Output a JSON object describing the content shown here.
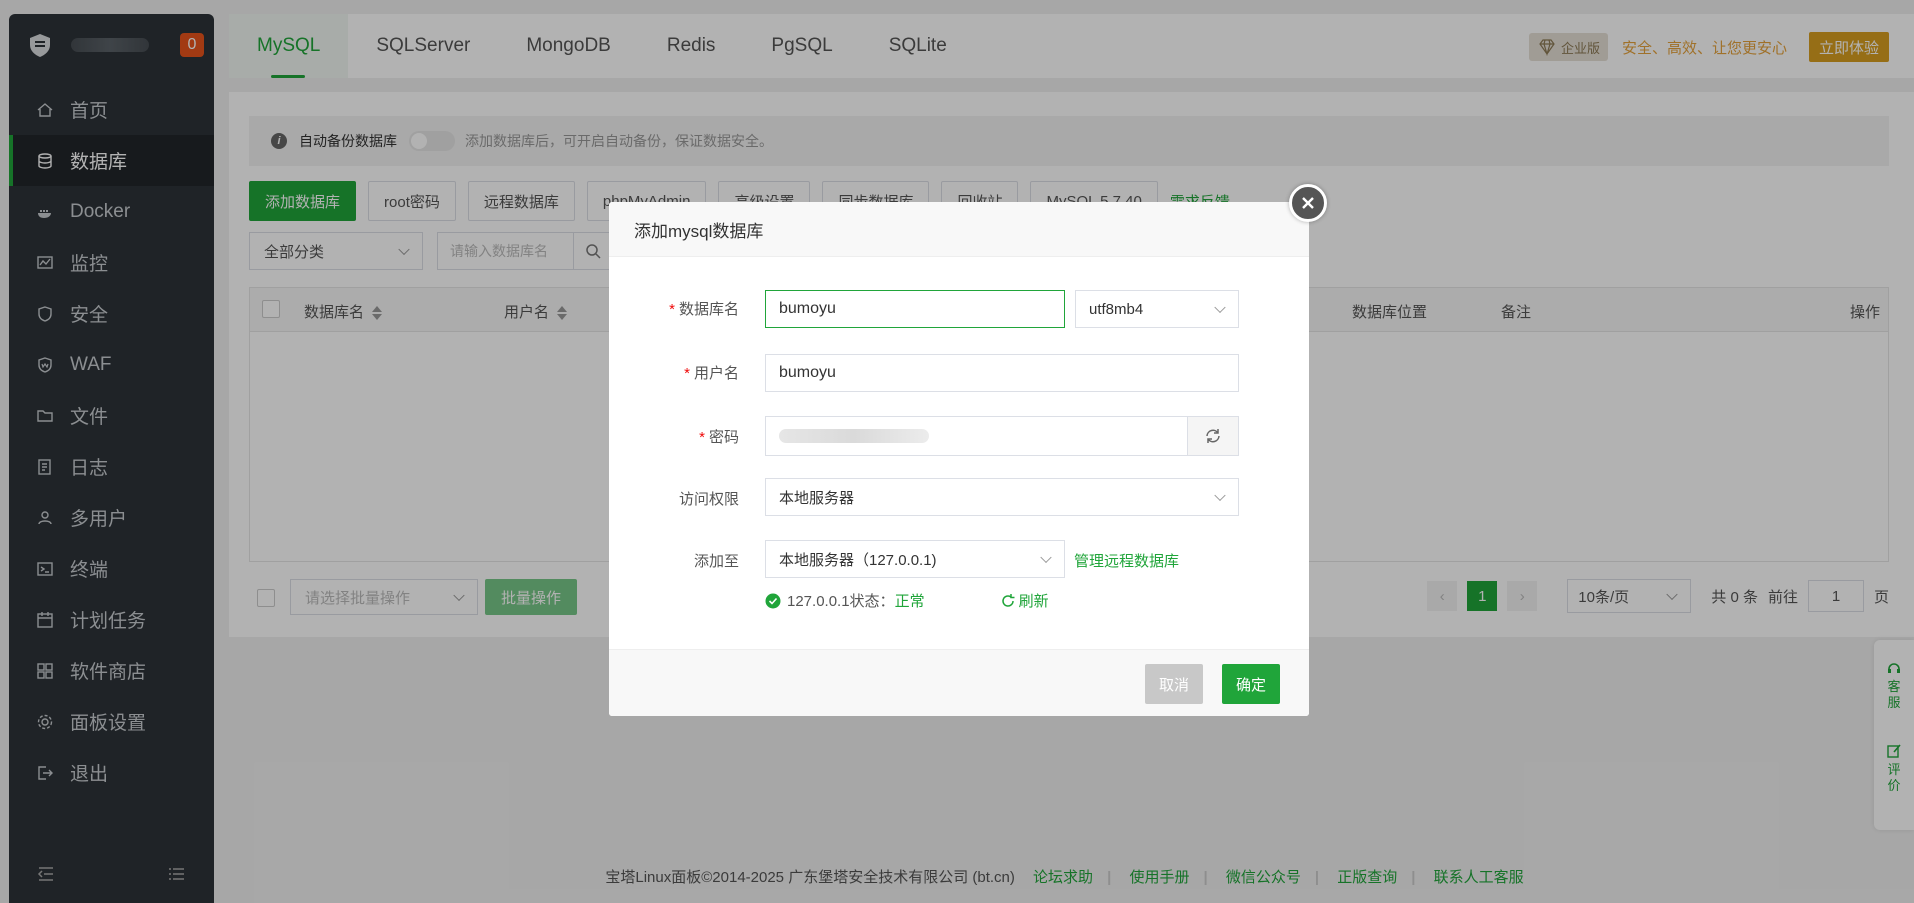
{
  "sidebar": {
    "badge": "0",
    "items": [
      {
        "label": "首页",
        "icon": "home-icon"
      },
      {
        "label": "数据库",
        "icon": "database-icon",
        "active": true
      },
      {
        "label": "Docker",
        "icon": "docker-icon"
      },
      {
        "label": "监控",
        "icon": "monitor-icon"
      },
      {
        "label": "安全",
        "icon": "shield-icon"
      },
      {
        "label": "WAF",
        "icon": "waf-icon"
      },
      {
        "label": "文件",
        "icon": "folder-icon"
      },
      {
        "label": "日志",
        "icon": "log-icon"
      },
      {
        "label": "多用户",
        "icon": "users-icon"
      },
      {
        "label": "终端",
        "icon": "terminal-icon"
      },
      {
        "label": "计划任务",
        "icon": "calendar-icon"
      },
      {
        "label": "软件商店",
        "icon": "apps-icon"
      },
      {
        "label": "面板设置",
        "icon": "gear-icon"
      },
      {
        "label": "退出",
        "icon": "logout-icon"
      }
    ]
  },
  "tabs": [
    "MySQL",
    "SQLServer",
    "MongoDB",
    "Redis",
    "PgSQL",
    "SQLite"
  ],
  "enterprise": {
    "badge": "企业版",
    "slogan": "安全、高效、让您更安心",
    "try": "立即体验"
  },
  "info_bar": {
    "label": "自动备份数据库",
    "hint": "添加数据库后，可开启自动备份，保证数据安全。"
  },
  "toolbar": {
    "add_db": "添加数据库",
    "root_pw": "root密码",
    "remote_db": "远程数据库",
    "phpmyadmin": "phpMyAdmin",
    "advanced": "高级设置",
    "sync": "同步数据库",
    "recycle": "回收站",
    "version": "MySQL 5.7.40",
    "feedback": "需求反馈"
  },
  "filter": {
    "category": "全部分类",
    "search_placeholder": "请输入数据库名"
  },
  "table": {
    "headers": {
      "name": "数据库名",
      "user": "用户名",
      "location": "数据库位置",
      "remark": "备注",
      "ops": "操作"
    }
  },
  "batch": {
    "placeholder": "请选择批量操作",
    "button": "批量操作"
  },
  "pager": {
    "current": "1",
    "size": "10条/页",
    "total": "共 0 条",
    "goto": "前往",
    "page_input": "1",
    "page_unit": "页"
  },
  "side_float": {
    "service": "客服",
    "rate": "评价"
  },
  "copyright": {
    "text": "宝塔Linux面板©2014-2025 广东堡塔安全技术有限公司 (bt.cn)",
    "links": [
      "论坛求助",
      "使用手册",
      "微信公众号",
      "正版查询",
      "联系人工客服"
    ]
  },
  "dialog": {
    "title": "添加mysql数据库",
    "db_name_label": "数据库名",
    "db_name_value": "bumoyu",
    "charset": "utf8mb4",
    "user_label": "用户名",
    "user_value": "bumoyu",
    "password_label": "密码",
    "access_label": "访问权限",
    "access_value": "本地服务器",
    "add_to_label": "添加至",
    "add_to_value": "本地服务器（127.0.0.1)",
    "manage_remote": "管理远程数据库",
    "status_text": "127.0.0.1状态：",
    "status_value": "正常",
    "refresh": "刷新",
    "cancel": "取消",
    "confirm": "确定"
  },
  "colors": {
    "accent": "#20a53a",
    "sidebar_bg": "#2d3338",
    "badge": "#e8541c",
    "enterprise_gold": "#d79e20"
  }
}
